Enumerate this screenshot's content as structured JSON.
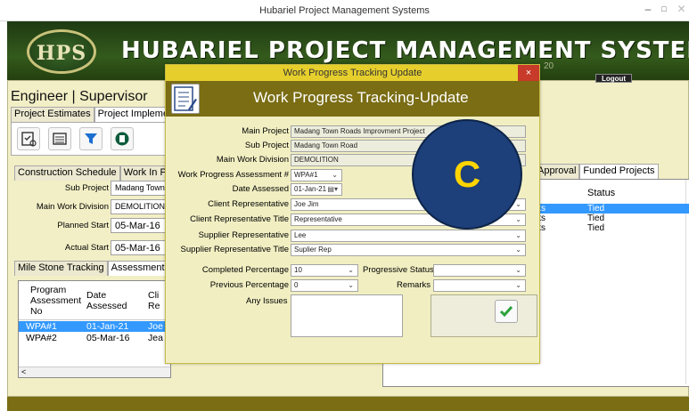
{
  "window": {
    "title": "Hubariel Project Management Systems",
    "min": "–",
    "max": "□",
    "close": "✕"
  },
  "banner": {
    "logo_text": "HPS",
    "title": "HUBARIEL PROJECT MANAGEMENT SYSTEM",
    "year_fragment": "20",
    "logout": "Logout"
  },
  "role_label": "Engineer | Supervisor",
  "main_tabs": [
    "Project Estimates",
    "Project Implemen"
  ],
  "toolbar_icons": [
    "checklist-icon",
    "keyboard-icon",
    "filter-icon",
    "ledger-icon"
  ],
  "toolbar_partial": "D",
  "sub_tabs": [
    "Construction Schedule",
    "Work In Pr"
  ],
  "left_fields": [
    {
      "label": "Sub Project",
      "value": "Madang Town R"
    },
    {
      "label": "Main Work Division",
      "value": "DEMOLITION"
    },
    {
      "label": "Planned Start",
      "value": "05-Mar-16"
    },
    {
      "label": "Actual Start",
      "value": "05-Mar-16"
    }
  ],
  "lower_tabs": [
    "Mile Stone Tracking",
    "Assessment"
  ],
  "left_grid": {
    "columns": [
      "Program Assessment No",
      "Date Assessed",
      "Cli Re"
    ],
    "rows": [
      {
        "no": "WPA#1",
        "date": "01-Jan-21",
        "client": "Joe",
        "selected": true
      },
      {
        "no": "WPA#2",
        "date": "05-Mar-16",
        "client": "Jea",
        "selected": false
      }
    ],
    "scroll_left": "<",
    "scroll_right": ">"
  },
  "right_tabs": [
    "Approval",
    "Funded Projects"
  ],
  "right_grid": {
    "status_header": "Status",
    "rows": [
      {
        "prefix": "ks",
        "status": "Tied",
        "selected": true
      },
      {
        "prefix": "ks",
        "status": "Tied",
        "selected": false
      },
      {
        "prefix": "ks",
        "status": "Tied",
        "selected": false
      }
    ]
  },
  "dialog": {
    "window_title": "Work Progress Tracking Update",
    "close": "×",
    "heading": "Work Progress Tracking-Update",
    "main_project": {
      "label": "Main Project",
      "value": "Madang Town Roads Improvment Project"
    },
    "sub_project": {
      "label": "Sub Project",
      "value": "Madang Town Road"
    },
    "main_division": {
      "label": "Main Work Division",
      "value": "DEMOLITION"
    },
    "assessment_no": {
      "label": "Work Progress Assessment #",
      "value": "WPA#1"
    },
    "date_assessed": {
      "label": "Date Assessed",
      "value": "01-Jan-21"
    },
    "client_rep": {
      "label": "Client Representative",
      "value": "Joe Jim"
    },
    "client_rep_title": {
      "label": "Client Representative Title",
      "value": "Representative"
    },
    "supplier_rep": {
      "label": "Supplier Representative",
      "value": "Lee"
    },
    "supplier_rep_title": {
      "label": "Supplier Representative Title",
      "value": "Suplier Rep"
    },
    "completed_pct": {
      "label": "Completed Percentage",
      "value": "10"
    },
    "progressive_status": {
      "label": "Progressive Status",
      "value": ""
    },
    "previous_pct": {
      "label": "Previous Percentage",
      "value": "0"
    },
    "remarks": {
      "label": "Remarks",
      "value": ""
    },
    "issues": {
      "label": "Any Issues",
      "value": ""
    }
  },
  "overlay_badge": "C",
  "colors": {
    "banner": "#2c4a18",
    "dialog_header": "#7a6d14",
    "dialog_titlebar": "#e6cf2c",
    "selection": "#3399ff",
    "badge": "#1d3f7a",
    "badge_text": "#ffd400"
  }
}
